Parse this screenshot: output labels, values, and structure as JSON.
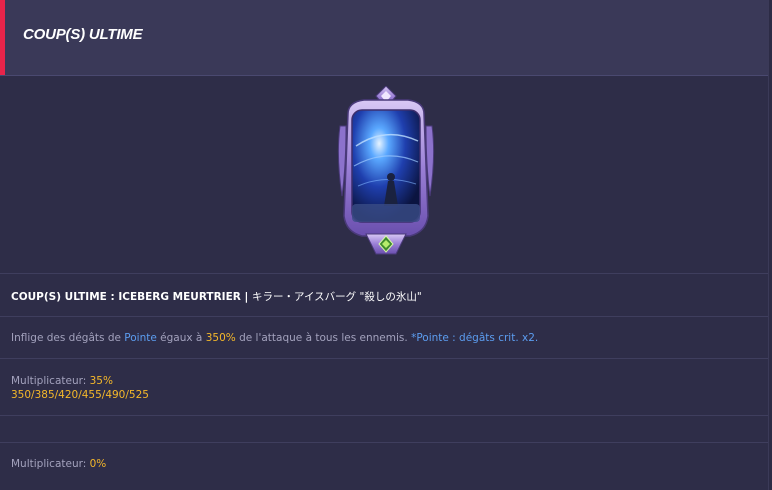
{
  "header": {
    "title": "COUP(S) ULTIME",
    "accent_color": "#e8244a"
  },
  "skill": {
    "card_icon": "ultimate-card-art",
    "title_prefix": "COUP(S) ULTIME : ICEBERG MEURTRIER | ",
    "title_jp": "キラー・アイスバーグ \"殺しの氷山\"",
    "description": {
      "part1": "Inflige des dégâts de ",
      "keyword": "Pointe",
      "part2": " égaux à ",
      "percent": "350%",
      "part3": " de l'attaque à tous les ennemis. ",
      "note": "*Pointe : dégâts crit. x2."
    }
  },
  "multipliers": [
    {
      "label": "Multiplicateur: ",
      "value": "35%",
      "levels": "350/385/420/455/490/525"
    },
    {
      "label": "Multiplicateur: ",
      "value": "0%"
    }
  ],
  "colors": {
    "keyword": "#5c9df0",
    "highlight": "#f5b82a",
    "background": "#2e2d48"
  }
}
